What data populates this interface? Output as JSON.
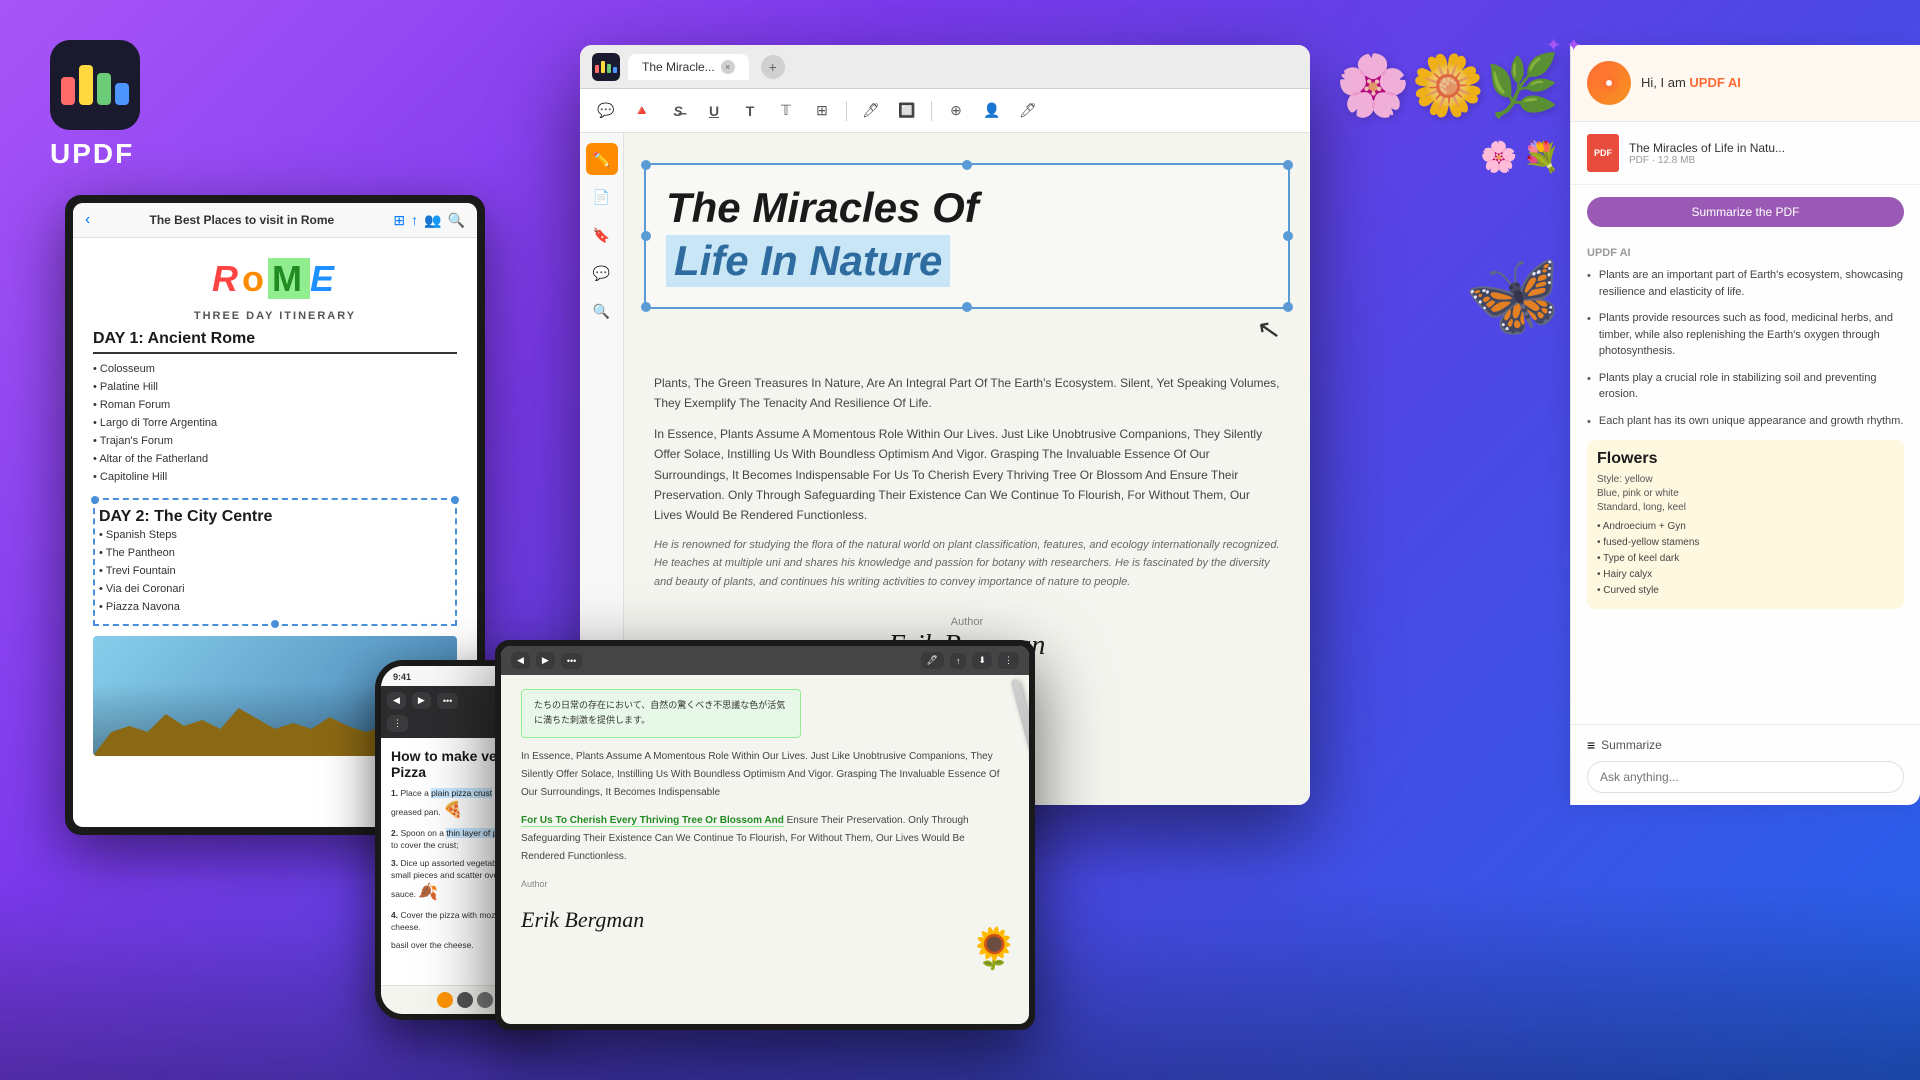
{
  "app": {
    "name": "UPDF",
    "tagline": "UPDF"
  },
  "titlebar": {
    "tab_name": "The Miracle...",
    "close_label": "×",
    "add_label": "+"
  },
  "toolbar": {
    "icons": [
      "💬",
      "🔺",
      "S",
      "U",
      "T",
      "T",
      "🔲",
      "T",
      "🔲",
      "⊕",
      "👤",
      "🖊"
    ]
  },
  "sidebar": {
    "tools": [
      "📝",
      "✏️",
      "📄",
      "🔖",
      "📋"
    ]
  },
  "pdf_content": {
    "title_line1": "The Miracles Of",
    "title_line2": "Life In Nature",
    "body_text": "Plants, The Green Treasures In Nature, Are An Integral Part Of The Earth's Ecosystem. Silent, Yet Speaking Volumes, They Exemplify The Tenacity And Resilience Of Life.",
    "body_text2": "In Essence, Plants Assume A Momentous Role Within Our Lives. Just Like Unobtrusive Companions, They Silently Offer Solace, Instilling Us With Boundless Optimism And Vigor. Grasping The Invaluable Essence Of Our Surroundings, It Becomes Indispensable For Us To Cherish Every Thriving Tree Or Blossom And Ensure Their Preservation. Only Through Safeguarding Their Existence Can We Continue To Flourish, For Without Them, Our Lives Would Be Rendered Functionless.",
    "body_text3": "He is renowned for studying the flora of the natural world on plant classification, features, and ecology internationally recognized. He teaches at multiple uni and shares his knowledge and passion for botany with researchers. He is fascinated by the diversity and beauty of plants, and continues his writing activities to convey importance of nature to people.",
    "author_label": "Author",
    "author_name": "Erik Bergman"
  },
  "ai_panel": {
    "greeting": "Hi, I am UPDF AI",
    "doc_name": "The Miracles of Life in Natu...",
    "doc_size": "PDF · 12.8 MB",
    "summarize_btn": "Summarize the PDF",
    "section_label": "UPDF AI",
    "points": [
      "Plants are an important part of Earth's ecosystem, showcasing resilience and elasticity of life.",
      "Plants provide resources such as food, medicinal herbs, and timber, while also replenishing the Earth's oxygen through photosynthesis.",
      "Plants play a crucial role in stabilizing soil and preventing erosion.",
      "Each plant has its own unique appearance and growth rhythm."
    ],
    "summarize_bottom": "Summarize",
    "ask_placeholder": "Ask anything..."
  },
  "tablet": {
    "title": "The Best Places to visit in Rome",
    "itinerary_label": "THREE DAY ITINERARY",
    "day1_header": "DAY 1: Ancient Rome",
    "day1_items": [
      "Colosseum",
      "Palatine Hill",
      "Roman Forum",
      "Largo di Torre Argentina",
      "Trajan's Forum",
      "Altar of the Fatherland",
      "Capitoline Hill"
    ],
    "day2_header": "DAY 2: The City Centre",
    "day2_items": [
      "Spanish Steps",
      "The Pantheon",
      "Trevi Fountain",
      "Via dei Coronari",
      "Piazza Navona"
    ]
  },
  "phone": {
    "time": "9:41",
    "title": "How to make veggie Pizza",
    "steps": [
      {
        "num": "1.",
        "text": "Place a plain pizza crust on a greased pan."
      },
      {
        "num": "2.",
        "text": "Spoon on a thin layer of pizza sauce to cover the crust;"
      },
      {
        "num": "3.",
        "text": "Dice up assorted vegetables into small pieces and scatter over the sauce."
      },
      {
        "num": "4.",
        "text": "Cover the pizza with mozzarella cheese."
      },
      {
        "num": "",
        "text": "basil over the cheese."
      }
    ]
  },
  "ipad": {
    "japanese_text": "たちの日常の存在において、自然の驚くべき不思議な色が活気に満ちた刺激を提供します。",
    "main_text1": "In Essence, Plants Assume A Momentous Role Within Our Lives. Just Like Unobtrusive Companions, They Silently Offer Solace, Instilling Us With",
    "green_text": "For Us To Cherish Every Thriving Tree Or Blossom And",
    "main_text2": "Ensure Their Preservation. Only Through Safeguarding Their Existence Can We Continue To Flourish, For Without Them, Our Lives Would Be Rendered Functionless.",
    "author_label": "Author",
    "author_name": "Erik Bergman",
    "flowers_section": {
      "header": "Flowers",
      "style_yellow": "Style: yellow",
      "style_blue": "Blue, pink or white",
      "style_standard": "Standard, long, keel",
      "notes": [
        "Androecium + Gyn",
        "fused-yellow stamens",
        "Type of keel dark",
        "Hairy calyx",
        "Curved style"
      ]
    }
  }
}
